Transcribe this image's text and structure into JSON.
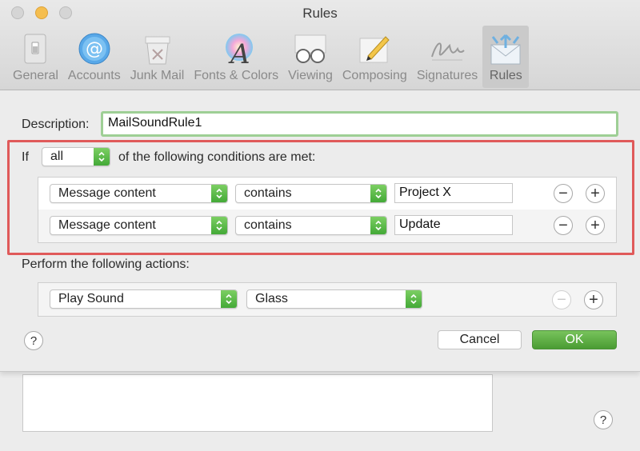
{
  "window": {
    "title": "Rules"
  },
  "toolbar": {
    "items": [
      {
        "label": "General",
        "icon": "general-switch-icon"
      },
      {
        "label": "Accounts",
        "icon": "at-sign-icon"
      },
      {
        "label": "Junk Mail",
        "icon": "junk-mail-bin-icon"
      },
      {
        "label": "Fonts & Colors",
        "icon": "font-colors-icon"
      },
      {
        "label": "Viewing",
        "icon": "glasses-icon"
      },
      {
        "label": "Composing",
        "icon": "pencil-paper-icon"
      },
      {
        "label": "Signatures",
        "icon": "signature-icon"
      },
      {
        "label": "Rules",
        "icon": "rules-envelope-icon",
        "active": true
      }
    ]
  },
  "rule": {
    "description_label": "Description:",
    "description_value": "MailSoundRule1",
    "if_label": "If",
    "match_value": "all",
    "conditions_suffix": "of the following conditions are met:",
    "conditions": [
      {
        "field": "Message content",
        "operator": "contains",
        "value": "Project X"
      },
      {
        "field": "Message content",
        "operator": "contains",
        "value": "Update"
      }
    ],
    "actions_label": "Perform the following actions:",
    "actions": [
      {
        "action": "Play Sound",
        "sound": "Glass"
      }
    ]
  },
  "buttons": {
    "cancel": "Cancel",
    "ok": "OK",
    "help": "?",
    "remove": "−",
    "add": "+"
  },
  "colors": {
    "highlight": "#e05a5a",
    "accent_green": "#4a9c33",
    "focus_ring": "#9ecf95"
  }
}
